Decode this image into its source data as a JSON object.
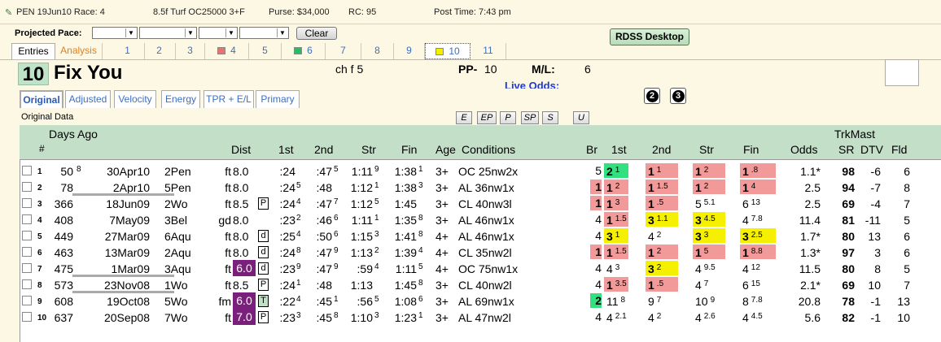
{
  "header": {
    "track_race": "PEN 19Jun10 Race: 4",
    "distance_surface": "8.5f  Turf  OC25000  3+F",
    "purse": "Purse: $34,000",
    "rc": "RC: 95",
    "post_time": "Post Time: 7:43 pm"
  },
  "pace": {
    "label": "Projected Pace:",
    "clear": "Clear"
  },
  "rdss_label": "RDSS Desktop",
  "tabs": [
    "Entries",
    "Analysis",
    "1",
    "2",
    "3",
    "4",
    "5",
    "6",
    "7",
    "8",
    "9",
    "10",
    "11"
  ],
  "tab_swatches": {
    "4": "#f07070",
    "6": "#20c060",
    "10": "#f0f000"
  },
  "horse": {
    "number": "10",
    "name": "Fix You",
    "desc": "ch f 5",
    "pp_label": "PP-",
    "pp": "10",
    "ml_label": "M/L:",
    "ml": "6",
    "live_odds": "Live Odds:"
  },
  "subtabs": [
    "Original",
    "Adjusted",
    "Velocity",
    "Energy",
    "TPR + E/L",
    "Primary"
  ],
  "icons": [
    "circle-2-icon",
    "circle-3-icon"
  ],
  "circle_labels": [
    "2",
    "3"
  ],
  "section_label": "Original Data",
  "filter_buttons": [
    "E",
    "EP",
    "P",
    "SP",
    "S",
    "U"
  ],
  "columns": {
    "days_ago": "Days Ago",
    "num": "#",
    "dist": "Dist",
    "first": "1st",
    "second": "2nd",
    "str": "Str",
    "fin": "Fin",
    "age": "Age",
    "conditions": "Conditions",
    "br": "Br",
    "c1st": "1st",
    "c2nd": "2nd",
    "cstr": "Str",
    "cfin": "Fin",
    "odds": "Odds",
    "trkmast": "TrkMast",
    "sr": "SR",
    "dtv": "DTV",
    "fld": "Fld"
  },
  "colors": {
    "red": "#f29a9a",
    "green": "#33e080",
    "yellow": "#f5f000",
    "purple": "#7b1f7d",
    "header_green": "#c3dfc8"
  },
  "rows": [
    {
      "n": "1",
      "days": "50",
      "dsup": "8",
      "date": "30Apr10",
      "race": "2Pen",
      "surf": "ft",
      "dist": "8.0",
      "sb": "",
      "dhl": false,
      "f1": ":24",
      "f2": ":47",
      "f2s": "5",
      "str": "1:11",
      "strs": "9",
      "fin": "1:38",
      "fins": "1",
      "age": "3+",
      "cond": "OC 25nw2x",
      "br": "5",
      "brc": "",
      "c1": "2",
      "c1s": "1",
      "c1c": "green",
      "c2": "1",
      "c2s": "1",
      "c2c": "red",
      "cs": "1",
      "css": "2",
      "csc": "red",
      "cf": "1",
      "cfs": ".8",
      "cfc": "red",
      "odds": "1.1*",
      "sr": "98",
      "dtv": "-6",
      "fld": "6"
    },
    {
      "n": "2",
      "days": "78",
      "dsup": "",
      "date": "2Apr10",
      "race": "5Pen",
      "surf": "ft",
      "dist": "8.0",
      "sb": "",
      "dhl": false,
      "f1": ":24",
      "f1s": "5",
      "f2": ":48",
      "f2s": "",
      "str": "1:12",
      "strs": "1",
      "fin": "1:38",
      "fins": "3",
      "age": "3+",
      "cond": "AL 36nw1x",
      "br": "1",
      "brc": "red",
      "c1": "1",
      "c1s": "2",
      "c1c": "red",
      "c2": "1",
      "c2s": "1.5",
      "c2c": "red",
      "cs": "1",
      "css": "2",
      "csc": "red",
      "cf": "1",
      "cfs": "4",
      "cfc": "red",
      "odds": "2.5",
      "sr": "94",
      "dtv": "-7",
      "fld": "8"
    },
    {
      "n": "3",
      "days": "366",
      "dsup": "",
      "date": "18Jun09",
      "race": "2Wo",
      "surf": "ft",
      "dist": "8.5",
      "sb": "P",
      "dhl": false,
      "f1": ":24",
      "f1s": "4",
      "f2": ":47",
      "f2s": "7",
      "str": "1:12",
      "strs": "5",
      "fin": "1:45",
      "fins": "",
      "age": "3+",
      "cond": "CL 40nw3l",
      "br": "1",
      "brc": "red",
      "c1": "1",
      "c1s": "3",
      "c1c": "red",
      "c2": "1",
      "c2s": ".5",
      "c2c": "red",
      "cs": "5",
      "css": "5.1",
      "csc": "",
      "cf": "6",
      "cfs": "13",
      "cfc": "",
      "odds": "2.5",
      "sr": "69",
      "dtv": "-4",
      "fld": "7"
    },
    {
      "n": "4",
      "days": "408",
      "dsup": "",
      "date": "7May09",
      "race": "3Bel",
      "surf": "gd",
      "dist": "8.0",
      "sb": "",
      "dhl": false,
      "f1": ":23",
      "f1s": "2",
      "f2": ":46",
      "f2s": "6",
      "str": "1:11",
      "strs": "1",
      "fin": "1:35",
      "fins": "8",
      "age": "3+",
      "cond": "AL 46nw1x",
      "br": "4",
      "brc": "",
      "c1": "1",
      "c1s": "1.5",
      "c1c": "red",
      "c2": "3",
      "c2s": "1.1",
      "c2c": "yellow",
      "cs": "3",
      "css": "4.5",
      "csc": "yellow",
      "cf": "4",
      "cfs": "7.8",
      "cfc": "",
      "odds": "11.4",
      "sr": "81",
      "dtv": "-11",
      "fld": "5"
    },
    {
      "n": "5",
      "days": "449",
      "dsup": "",
      "date": "27Mar09",
      "race": "6Aqu",
      "surf": "ft",
      "dist": "8.0",
      "sb": "d",
      "dhl": false,
      "f1": ":25",
      "f1s": "4",
      "f2": ":50",
      "f2s": "6",
      "str": "1:15",
      "strs": "3",
      "fin": "1:41",
      "fins": "8",
      "age": "4+",
      "cond": "AL 46nw1x",
      "br": "4",
      "brc": "",
      "c1": "3",
      "c1s": "1",
      "c1c": "yellow",
      "c2": "4",
      "c2s": "2",
      "c2c": "",
      "cs": "3",
      "css": "3",
      "csc": "yellow",
      "cf": "3",
      "cfs": "2.5",
      "cfc": "yellow",
      "odds": "1.7*",
      "sr": "80",
      "dtv": "13",
      "fld": "6"
    },
    {
      "n": "6",
      "days": "463",
      "dsup": "",
      "date": "13Mar09",
      "race": "2Aqu",
      "surf": "ft",
      "dist": "8.0",
      "sb": "d",
      "dhl": false,
      "f1": ":24",
      "f1s": "8",
      "f2": ":47",
      "f2s": "9",
      "str": "1:13",
      "strs": "2",
      "fin": "1:39",
      "fins": "4",
      "age": "4+",
      "cond": "CL 35nw2l",
      "br": "1",
      "brc": "red",
      "c1": "1",
      "c1s": "1.5",
      "c1c": "red",
      "c2": "1",
      "c2s": "2",
      "c2c": "red",
      "cs": "1",
      "css": "5",
      "csc": "red",
      "cf": "1",
      "cfs": "8.8",
      "cfc": "red",
      "odds": "1.3*",
      "sr": "97",
      "dtv": "3",
      "fld": "6"
    },
    {
      "n": "7",
      "days": "475",
      "dsup": "",
      "date": "1Mar09",
      "race": "3Aqu",
      "surf": "ft",
      "dist": "6.0",
      "sb": "d",
      "dhl": true,
      "f1": ":23",
      "f1s": "9",
      "f2": ":47",
      "f2s": "9",
      "str": ":59",
      "strs": "4",
      "fin": "1:11",
      "fins": "5",
      "age": "4+",
      "cond": "OC 75nw1x",
      "br": "4",
      "brc": "",
      "c1": "4",
      "c1s": "3",
      "c1c": "",
      "c2": "3",
      "c2s": "2",
      "c2c": "yellow",
      "cs": "4",
      "css": "9.5",
      "csc": "",
      "cf": "4",
      "cfs": "12",
      "cfc": "",
      "odds": "11.5",
      "sr": "80",
      "dtv": "8",
      "fld": "5"
    },
    {
      "n": "8",
      "days": "573",
      "dsup": "",
      "date": "23Nov08",
      "race": "1Wo",
      "surf": "ft",
      "dist": "8.5",
      "sb": "P",
      "dhl": false,
      "f1": ":24",
      "f1s": "1",
      "f2": ":48",
      "f2s": "",
      "str": "1:13",
      "strs": "",
      "fin": "1:45",
      "fins": "8",
      "age": "3+",
      "cond": "CL 40nw2l",
      "br": "4",
      "brc": "",
      "c1": "1",
      "c1s": "3.5",
      "c1c": "red",
      "c2": "1",
      "c2s": ".5",
      "c2c": "red",
      "cs": "4",
      "css": "7",
      "csc": "",
      "cf": "6",
      "cfs": "15",
      "cfc": "",
      "odds": "2.1*",
      "sr": "69",
      "dtv": "10",
      "fld": "7"
    },
    {
      "n": "9",
      "days": "608",
      "dsup": "",
      "date": "19Oct08",
      "race": "5Wo",
      "surf": "fm",
      "dist": "6.0",
      "sb": "T",
      "dhl": true,
      "f1": ":22",
      "f1s": "4",
      "f2": ":45",
      "f2s": "1",
      "str": ":56",
      "strs": "5",
      "fin": "1:08",
      "fins": "6",
      "age": "3+",
      "cond": "AL 69nw1x",
      "br": "2",
      "brc": "green",
      "c1": "11",
      "c1s": "8",
      "c1c": "",
      "c2": "9",
      "c2s": "7",
      "c2c": "",
      "cs": "10",
      "css": "9",
      "csc": "",
      "cf": "8",
      "cfs": "7.8",
      "cfc": "",
      "odds": "20.8",
      "sr": "78",
      "dtv": "-1",
      "fld": "13"
    },
    {
      "n": "10",
      "days": "637",
      "dsup": "",
      "date": "20Sep08",
      "race": "7Wo",
      "surf": "ft",
      "dist": "7.0",
      "sb": "P",
      "dhl": true,
      "f1": ":23",
      "f1s": "3",
      "f2": ":45",
      "f2s": "8",
      "str": "1:10",
      "strs": "3",
      "fin": "1:23",
      "fins": "1",
      "age": "3+",
      "cond": "AL 47nw2l",
      "br": "4",
      "brc": "",
      "c1": "4",
      "c1s": "2.1",
      "c1c": "",
      "c2": "4",
      "c2s": "2",
      "c2c": "",
      "cs": "4",
      "css": "2.6",
      "csc": "",
      "cf": "4",
      "cfs": "4.5",
      "cfc": "",
      "odds": "5.6",
      "sr": "82",
      "dtv": "-1",
      "fld": "10"
    }
  ]
}
